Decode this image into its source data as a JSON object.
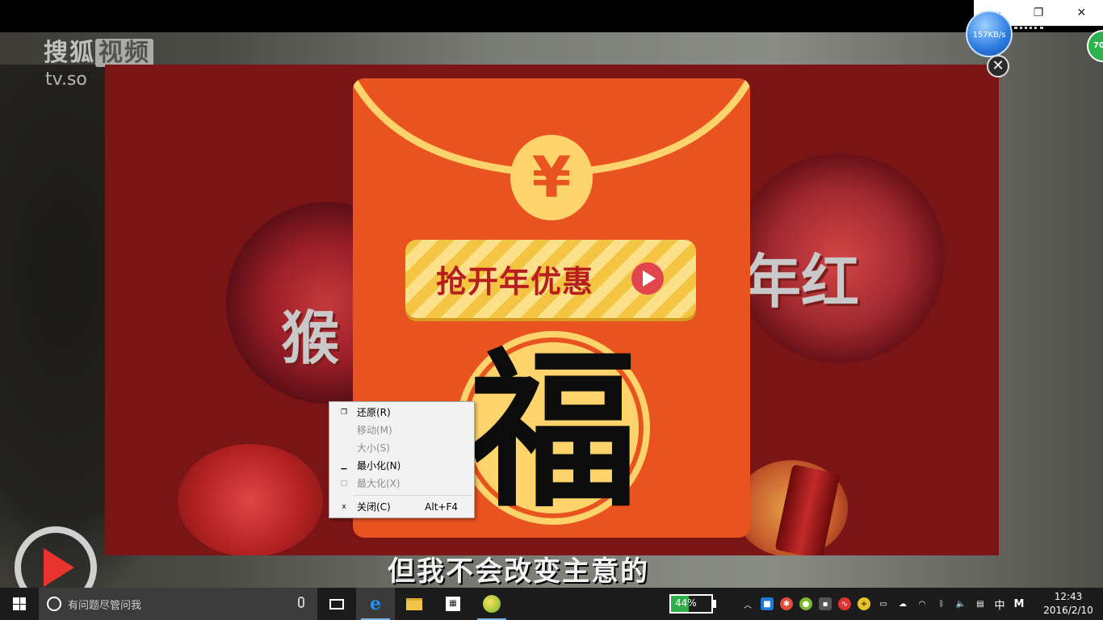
{
  "window": {
    "controls": [
      "—",
      "❐",
      "✕"
    ]
  },
  "player": {
    "watermark": "搜狐视频",
    "watermark_box": "视频",
    "watermark_main": "搜狐",
    "watermark_url": "tv.so",
    "subtitle": "但我不会改变主意的"
  },
  "ad": {
    "bg_left_text": "猴",
    "bg_right_text": "年红",
    "coin_symbol": "¥",
    "cta_label": "抢开年优惠",
    "fu": "福",
    "close": "✕"
  },
  "overlays": {
    "net_speed": "157KB/s",
    "green_ball": "70"
  },
  "context_menu": {
    "items": [
      {
        "glyph": "❐",
        "label": "还原(R)",
        "enabled": true
      },
      {
        "glyph": "",
        "label": "移动(M)",
        "enabled": false
      },
      {
        "glyph": "",
        "label": "大小(S)",
        "enabled": false
      },
      {
        "glyph": "▁",
        "label": "最小化(N)",
        "enabled": true
      },
      {
        "glyph": "□",
        "label": "最大化(X)",
        "enabled": false
      },
      {
        "glyph": "x",
        "label": "关闭(C)",
        "accel": "Alt+F4",
        "enabled": true
      }
    ]
  },
  "taskbar": {
    "search_placeholder": "有问题尽管问我",
    "battery_percent": 44,
    "battery_text": "44%",
    "ime": "中",
    "ime_mode": "M",
    "clock_time": "12:43",
    "clock_date": "2016/2/10"
  },
  "colors": {
    "envelope": "#e9531f",
    "gold": "#fdd36b",
    "cta_text": "#b81e1e",
    "taskbar": "#1c1c1c"
  }
}
